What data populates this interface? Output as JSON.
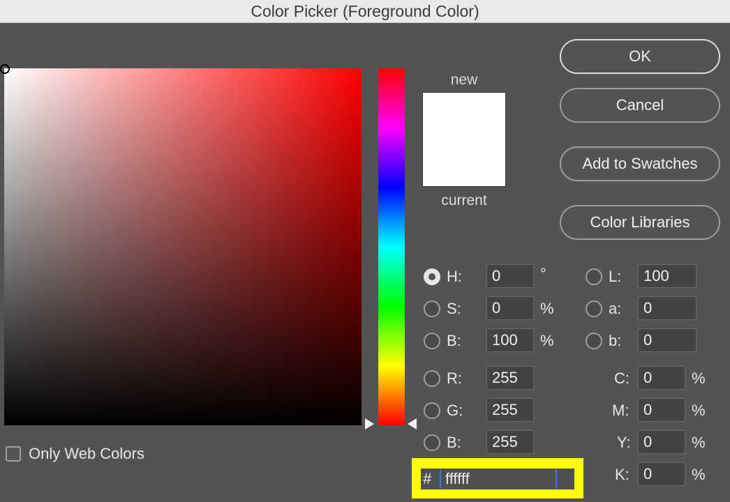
{
  "window": {
    "title": "Color Picker (Foreground Color)"
  },
  "preview": {
    "new_label": "new",
    "current_label": "current",
    "new_color": "#ffffff",
    "current_color": "#ffffff"
  },
  "buttons": {
    "ok": "OK",
    "cancel": "Cancel",
    "add_swatches": "Add to Swatches",
    "color_libraries": "Color Libraries"
  },
  "hsb": {
    "h": {
      "label": "H:",
      "value": "0",
      "unit": "°",
      "checked": true
    },
    "s": {
      "label": "S:",
      "value": "0",
      "unit": "%"
    },
    "b": {
      "label": "B:",
      "value": "100",
      "unit": "%"
    }
  },
  "rgb": {
    "r": {
      "label": "R:",
      "value": "255"
    },
    "g": {
      "label": "G:",
      "value": "255"
    },
    "b": {
      "label": "B:",
      "value": "255"
    }
  },
  "lab": {
    "l": {
      "label": "L:",
      "value": "100"
    },
    "a": {
      "label": "a:",
      "value": "0"
    },
    "b": {
      "label": "b:",
      "value": "0"
    }
  },
  "cmyk": {
    "c": {
      "label": "C:",
      "value": "0",
      "unit": "%"
    },
    "m": {
      "label": "M:",
      "value": "0",
      "unit": "%"
    },
    "y": {
      "label": "Y:",
      "value": "0",
      "unit": "%"
    },
    "k": {
      "label": "K:",
      "value": "0",
      "unit": "%"
    }
  },
  "hex": {
    "symbol": "#",
    "value": "ffffff"
  },
  "web_colors": {
    "label": "Only Web Colors",
    "checked": false
  },
  "colors": {
    "hue": "#ff0000",
    "highlight": "#ffff00",
    "cursor": "#3a7bd5"
  }
}
